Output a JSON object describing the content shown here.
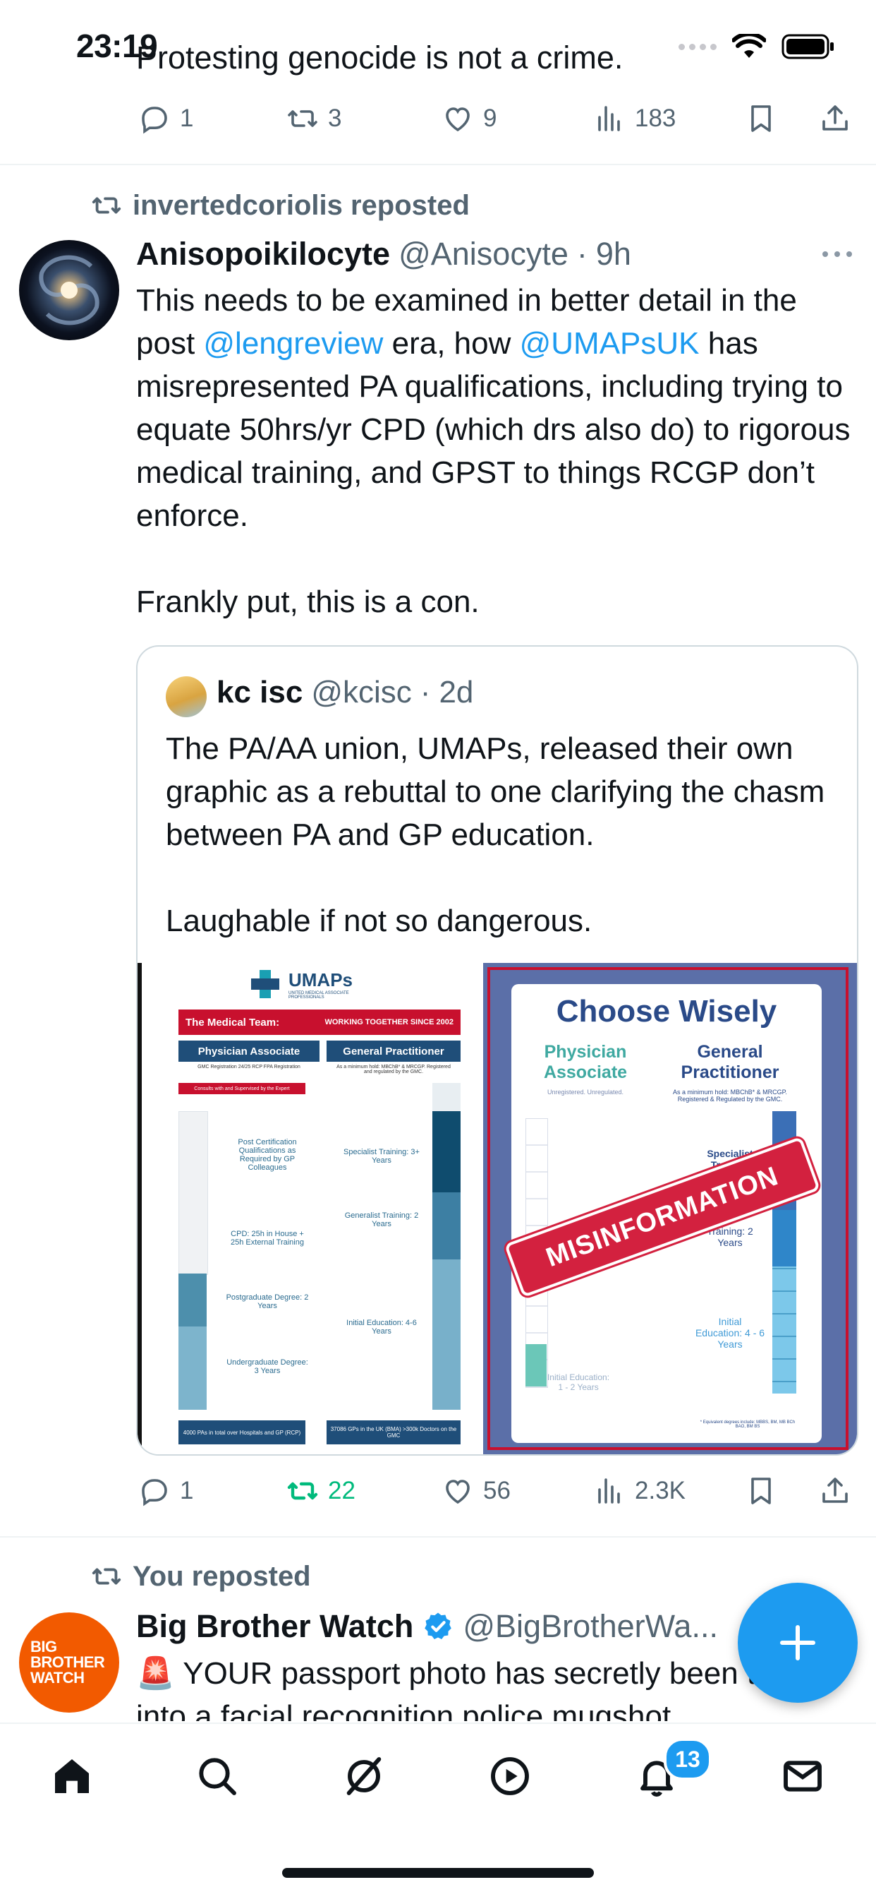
{
  "status_bar": {
    "time": "23:19"
  },
  "previous_tweet": {
    "text": "Protesting genocide is not a crime.",
    "replies": "1",
    "reposts": "3",
    "likes": "9",
    "views": "183"
  },
  "tweet1": {
    "repost_label": "invertedcoriolis reposted",
    "author_name": "Anisopoikilocyte",
    "author_handle": "@Anisocyte",
    "separator": "·",
    "time": "9h",
    "text_parts": {
      "p1": "This needs to be examined in better detail in the post ",
      "mention1": "@lengreview",
      "p2": " era, how ",
      "mention2": "@UMAPsUK",
      "p3": " has misrepresented PA qualifications, including trying to equate 50hrs/yr CPD (which drs also do) to rigorous medical training, and GPST to things RCGP don’t enforce.",
      "p4": "Frankly put, this is a con."
    },
    "quote": {
      "author_name": "kc isc",
      "author_handle": "@kcisc",
      "separator": "·",
      "time": "2d",
      "text1": "The PA/AA union, UMAPs, released their own graphic as a rebuttal to one clarifying the chasm between PA and GP education.",
      "text2": "Laughable if not so dangerous.",
      "left_graphic": {
        "logo": "UMAPs",
        "logo_sub": "UNITED MEDICAL ASSOCIATE PROFESSIONALS",
        "banner": "The Medical Team:",
        "banner_right": "WORKING TOGETHER SINCE 2002",
        "col1_title": "Physician Associate",
        "col2_title": "General Practitioner",
        "col1_sub": "GMC Registration 24/25 RCP FPA Registration",
        "col2_sub": "As a minimum hold: MBChB* & MRCGP. Registered and regulated by the GMC.",
        "red_note": "Consults with and Supervised by the Expert",
        "pa_items": [
          "Post Certification Qualifications as Required by GP Colleagues",
          "CPD: 25h in House + 25h External Training",
          "Postgraduate Degree: 2 Years",
          "Undergraduate Degree: 3 Years"
        ],
        "gp_items": [
          "Specialist Training: 3+ Years",
          "Generalist Training: 2 Years",
          "Initial Education: 4-6 Years"
        ],
        "footer1": "4000 PAs in total over Hospitals and GP (RCP)",
        "footer2": "37086 GPs in the UK (BMA) >300k Doctors on the GMC"
      },
      "right_graphic": {
        "title": "Choose Wisely",
        "col1_title": "Physician Associate",
        "col2_title": "General Practitioner",
        "col1_sub": "Unregistered. Unregulated.",
        "col2_sub": "As a minimum hold: MBChB* & MRCGP. Registered & Regulated by the GMC.",
        "specialist": "Specialist Training",
        "generalist": "Training: 2 Years",
        "initial_gp": "Initial Education: 4 - 6 Years",
        "initial_pa": "Initial Education: 1 - 2 Years",
        "stamp": "MISINFORMATION",
        "footnote": "* Equivalent degrees include: MBBS, BM, MB BCh BAO, BM BS"
      }
    },
    "replies": "1",
    "reposts": "22",
    "likes": "56",
    "views": "2.3K"
  },
  "tweet2": {
    "repost_label": "You reposted",
    "author_name": "Big Brother Watch",
    "author_handle": "@BigBrotherWa...",
    "avatar_text": "BIG BROTHER WATCH",
    "text": "🚨 YOUR passport photo has secretly been turned into a facial recognition police mugshot"
  },
  "tabbar": {
    "notifications_badge": "13"
  },
  "colors": {
    "accent": "#1d9bf0",
    "repost_green": "#00ba7c",
    "muted": "#536471"
  }
}
